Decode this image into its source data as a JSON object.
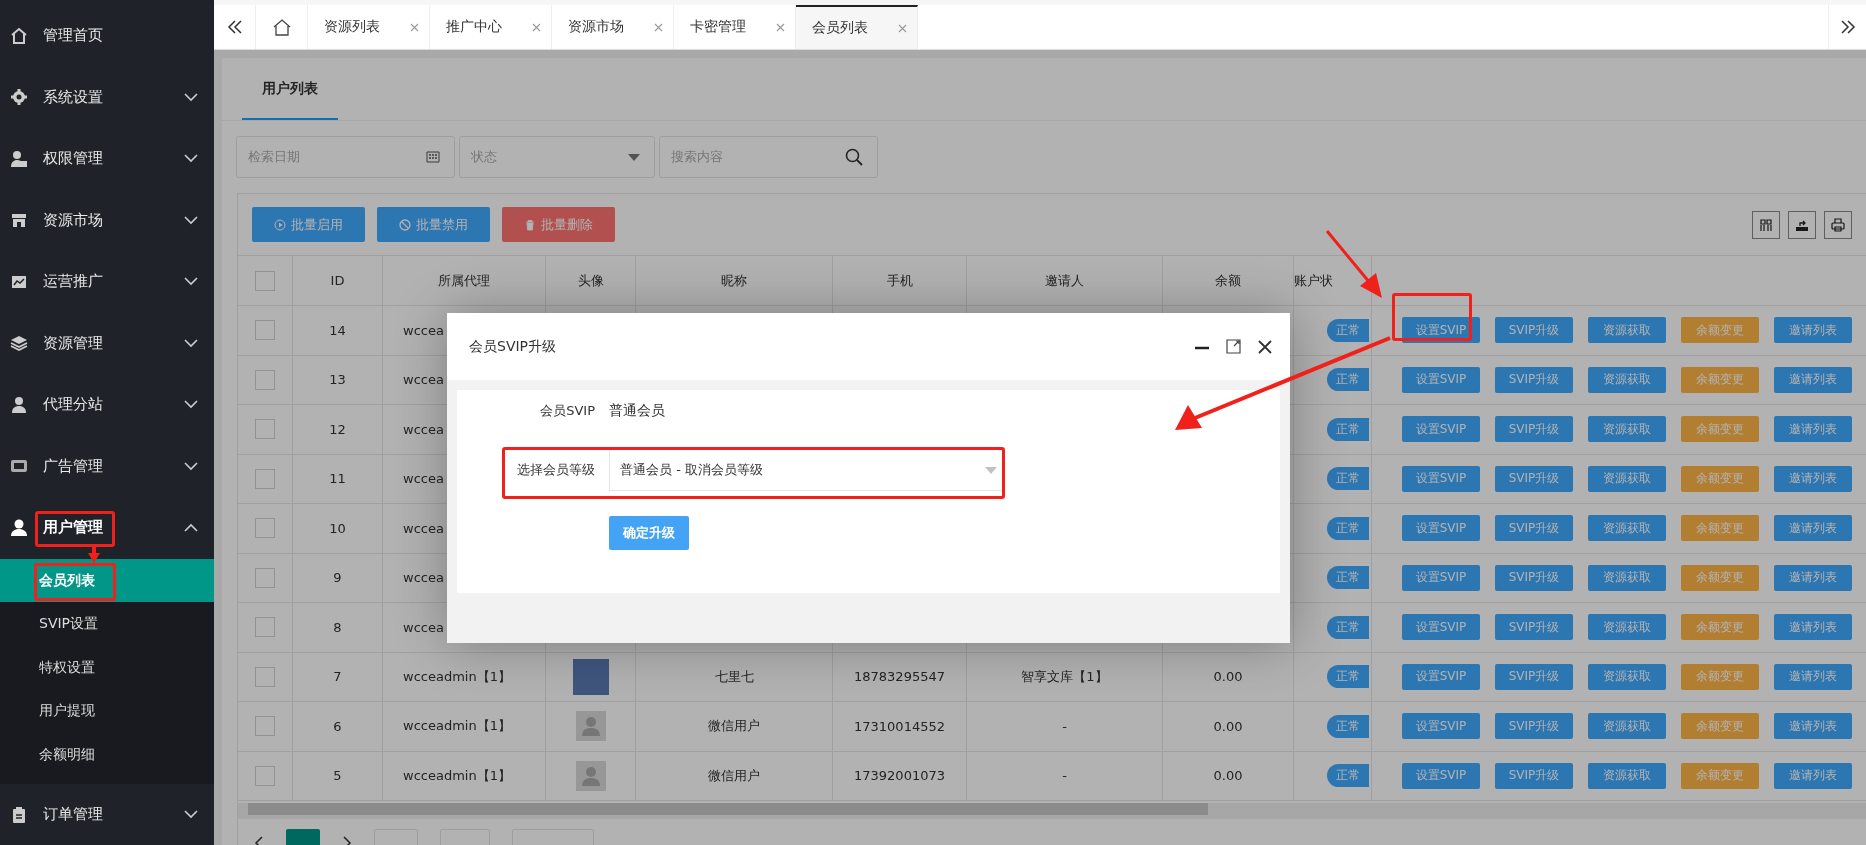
{
  "sidebar": {
    "items": [
      {
        "label": "管理首页"
      },
      {
        "label": "系统设置",
        "expanded": false
      },
      {
        "label": "权限管理",
        "expanded": false
      },
      {
        "label": "资源市场",
        "expanded": false
      },
      {
        "label": "运营推广",
        "expanded": false
      },
      {
        "label": "资源管理",
        "expanded": false
      },
      {
        "label": "代理分站",
        "expanded": false
      },
      {
        "label": "广告管理",
        "expanded": false
      },
      {
        "label": "用户管理",
        "expanded": true,
        "children": [
          {
            "label": "会员列表",
            "selected": true
          },
          {
            "label": "SVIP设置",
            "selected": false
          },
          {
            "label": "特权设置",
            "selected": false
          },
          {
            "label": "用户提现",
            "selected": false
          },
          {
            "label": "余额明细",
            "selected": false
          }
        ]
      },
      {
        "label": "订单管理",
        "expanded": false
      }
    ]
  },
  "tabs": [
    {
      "label": "资源列表",
      "selected": false
    },
    {
      "label": "推广中心",
      "selected": false
    },
    {
      "label": "资源市场",
      "selected": false
    },
    {
      "label": "卡密管理",
      "selected": false
    },
    {
      "label": "会员列表",
      "selected": true
    }
  ],
  "card_title": "用户列表",
  "filters": {
    "date_placeholder": "检索日期",
    "status_placeholder": "状态",
    "search_placeholder": "搜索内容"
  },
  "toolbar": [
    {
      "label": "批量启用",
      "kind": "enable"
    },
    {
      "label": "批量禁用",
      "kind": "disable"
    },
    {
      "label": "批量删除",
      "kind": "delete"
    }
  ],
  "table": {
    "select_all": {
      "checked": false
    },
    "columns": [
      "ID",
      "所属代理",
      "头像",
      "昵称",
      "手机",
      "邀请人",
      "余额",
      "账户状"
    ],
    "rows": [
      {
        "id": "14",
        "agent": "wccea",
        "status": "正常",
        "checked": false,
        "actions": [
          {
            "label": "设置SVIP",
            "kind": "primary"
          },
          {
            "label": "SVIP升级",
            "kind": "primary"
          },
          {
            "label": "资源获取",
            "kind": "primary"
          },
          {
            "label": "余额变更",
            "kind": "warning"
          },
          {
            "label": "邀请列表",
            "kind": "primary"
          }
        ]
      },
      {
        "id": "13",
        "agent": "wccea",
        "status": "正常",
        "checked": false,
        "actions": [
          {
            "label": "设置SVIP",
            "kind": "primary"
          },
          {
            "label": "SVIP升级",
            "kind": "primary"
          },
          {
            "label": "资源获取",
            "kind": "primary"
          },
          {
            "label": "余额变更",
            "kind": "warning"
          },
          {
            "label": "邀请列表",
            "kind": "primary"
          }
        ]
      },
      {
        "id": "12",
        "agent": "wccea",
        "status": "正常",
        "checked": false,
        "actions": [
          {
            "label": "设置SVIP",
            "kind": "primary"
          },
          {
            "label": "SVIP升级",
            "kind": "primary"
          },
          {
            "label": "资源获取",
            "kind": "primary"
          },
          {
            "label": "余额变更",
            "kind": "warning"
          },
          {
            "label": "邀请列表",
            "kind": "primary"
          }
        ]
      },
      {
        "id": "11",
        "agent": "wccea",
        "status": "正常",
        "checked": false,
        "actions": [
          {
            "label": "设置SVIP",
            "kind": "primary"
          },
          {
            "label": "SVIP升级",
            "kind": "primary"
          },
          {
            "label": "资源获取",
            "kind": "primary"
          },
          {
            "label": "余额变更",
            "kind": "warning"
          },
          {
            "label": "邀请列表",
            "kind": "primary"
          }
        ]
      },
      {
        "id": "10",
        "agent": "wccea",
        "status": "正常",
        "checked": false,
        "actions": [
          {
            "label": "设置SVIP",
            "kind": "primary"
          },
          {
            "label": "SVIP升级",
            "kind": "primary"
          },
          {
            "label": "资源获取",
            "kind": "primary"
          },
          {
            "label": "余额变更",
            "kind": "warning"
          },
          {
            "label": "邀请列表",
            "kind": "primary"
          }
        ]
      },
      {
        "id": "9",
        "agent": "wccea",
        "status": "正常",
        "checked": false,
        "actions": [
          {
            "label": "设置SVIP",
            "kind": "primary"
          },
          {
            "label": "SVIP升级",
            "kind": "primary"
          },
          {
            "label": "资源获取",
            "kind": "primary"
          },
          {
            "label": "余额变更",
            "kind": "warning"
          },
          {
            "label": "邀请列表",
            "kind": "primary"
          }
        ]
      },
      {
        "id": "8",
        "agent": "wccea",
        "status": "正常",
        "checked": false,
        "actions": [
          {
            "label": "设置SVIP",
            "kind": "primary"
          },
          {
            "label": "SVIP升级",
            "kind": "primary"
          },
          {
            "label": "资源获取",
            "kind": "primary"
          },
          {
            "label": "余额变更",
            "kind": "warning"
          },
          {
            "label": "邀请列表",
            "kind": "primary"
          }
        ]
      },
      {
        "id": "7",
        "agent": "wcceadmin【1】",
        "avatar": {
          "kind": "photo"
        },
        "nickname": "七里七",
        "phone": "18783295547",
        "inviter": "智享文库【1】",
        "balance": "0.00",
        "status": "正常",
        "checked": false,
        "actions": [
          {
            "label": "设置SVIP",
            "kind": "primary"
          },
          {
            "label": "SVIP升级",
            "kind": "primary"
          },
          {
            "label": "资源获取",
            "kind": "primary"
          },
          {
            "label": "余额变更",
            "kind": "warning"
          },
          {
            "label": "邀请列表",
            "kind": "primary"
          }
        ]
      },
      {
        "id": "6",
        "agent": "wcceadmin【1】",
        "avatar": {
          "kind": "default"
        },
        "nickname": "微信用户",
        "phone": "17310014552",
        "inviter": "-",
        "balance": "0.00",
        "status": "正常",
        "checked": false,
        "actions": [
          {
            "label": "设置SVIP",
            "kind": "primary"
          },
          {
            "label": "SVIP升级",
            "kind": "primary"
          },
          {
            "label": "资源获取",
            "kind": "primary"
          },
          {
            "label": "余额变更",
            "kind": "warning"
          },
          {
            "label": "邀请列表",
            "kind": "primary"
          }
        ]
      },
      {
        "id": "5",
        "agent": "wcceadmin【1】",
        "avatar": {
          "kind": "default"
        },
        "nickname": "微信用户",
        "phone": "17392001073",
        "inviter": "-",
        "balance": "0.00",
        "status": "正常",
        "checked": false,
        "actions": [
          {
            "label": "设置SVIP",
            "kind": "primary"
          },
          {
            "label": "SVIP升级",
            "kind": "primary"
          },
          {
            "label": "资源获取",
            "kind": "primary"
          },
          {
            "label": "余额变更",
            "kind": "warning"
          },
          {
            "label": "邀请列表",
            "kind": "primary"
          }
        ]
      }
    ]
  },
  "dialog": {
    "title": "会员SVIP升级",
    "current_label": "会员SVIP",
    "current_value": "普通会员",
    "select_label": "选择会员等级",
    "select_value": "普通会员 - 取消会员等级",
    "submit": "确定升级"
  }
}
